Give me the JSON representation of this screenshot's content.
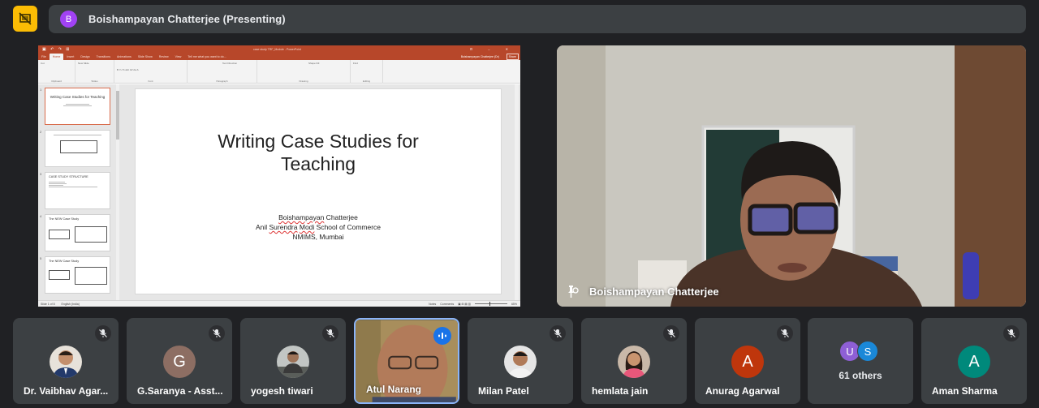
{
  "presenter": {
    "avatar_letter": "B",
    "avatar_color": "#a142f4",
    "label": "Boishampayan Chatterjee (Presenting)",
    "present_button_icon": "stop-presenting-icon",
    "present_button_color": "#fbbc04"
  },
  "powerpoint": {
    "window_title": "case study TRF_Module - PowerPoint",
    "user": "Boishampayan Chatterjee (Dr)",
    "share_label": "Share",
    "tabs": [
      "File",
      "Home",
      "Insert",
      "Design",
      "Transitions",
      "Animations",
      "Slide Show",
      "Review",
      "View",
      "Tell me what you want to do..."
    ],
    "active_tab": "Home",
    "ribbon_groups": [
      {
        "label": "Clipboard",
        "items": [
          "Paste",
          "Cut",
          "Copy",
          "Format Painter"
        ]
      },
      {
        "label": "Slides",
        "items": [
          "New Slide",
          "Layout",
          "Reset",
          "Section"
        ]
      },
      {
        "label": "Font",
        "items": [
          "B I U S abc AV Aa A"
        ]
      },
      {
        "label": "Paragraph",
        "items": [
          "Text Direction",
          "Align Text",
          "Convert to SmartArt"
        ]
      },
      {
        "label": "Drawing",
        "items": [
          "Arrange",
          "Quick Styles",
          "Shape Fill",
          "Shape Outline",
          "Shape Effects"
        ]
      },
      {
        "label": "Editing",
        "items": [
          "Find",
          "Replace",
          "Select"
        ]
      }
    ],
    "thumbnails": [
      {
        "num": "1",
        "title": "Writing Case Studies for Teaching",
        "selected": true
      },
      {
        "num": "2",
        "title": "",
        "selected": false
      },
      {
        "num": "3",
        "title": "CASE STUDY STRUCTURE",
        "selected": false
      },
      {
        "num": "4",
        "title": "The NEW Case Study",
        "selected": false
      },
      {
        "num": "5",
        "title": "The NEW Case Study",
        "selected": false
      }
    ],
    "slide": {
      "title_line1": "Writing Case Studies for",
      "title_line2": "Teaching",
      "author_first": "Boishampayan",
      "author_last": " Chatterjee",
      "inst_a": "Anil ",
      "inst_b": "Surendra",
      "inst_c": " ",
      "inst_d": "Modi",
      "inst_e": " School of Commerce",
      "location": "NMIMS, Mumbai"
    },
    "status": {
      "slide_count": "Slide 1 of 8",
      "language": "English (India)",
      "notes": "Notes",
      "comments": "Comments",
      "zoom": "65%"
    }
  },
  "main_video": {
    "name": "Boishampayan Chatterjee",
    "pin_icon": "pin-icon"
  },
  "participants": [
    {
      "name": "Dr. Vaibhav Agar...",
      "avatar_type": "photo",
      "photo_bg": "#e7e2da",
      "muted": true
    },
    {
      "name": "G.Saranya - Asst...",
      "avatar_type": "letter",
      "letter": "G",
      "color": "#8d6e63",
      "muted": true
    },
    {
      "name": "yogesh tiwari",
      "avatar_type": "photo",
      "photo_bg": "#c2c6c4",
      "muted": true
    },
    {
      "name": "Atul Narang",
      "avatar_type": "video",
      "muted": false,
      "speaking": true
    },
    {
      "name": "Milan Patel",
      "avatar_type": "photo",
      "photo_bg": "#e5e5e5",
      "muted": true
    },
    {
      "name": "hemlata jain",
      "avatar_type": "photo",
      "photo_bg": "#c9b8a8",
      "muted": true
    },
    {
      "name": "Anurag Agarwal",
      "avatar_type": "letter",
      "letter": "A",
      "color": "#bf360c",
      "muted": true
    },
    {
      "name": "Aman Sharma",
      "avatar_type": "letter",
      "letter": "A",
      "color": "#00897b",
      "muted": true
    }
  ],
  "others": {
    "label": "61 others",
    "avatars": [
      {
        "letter": "U",
        "color": "#8e5fd6"
      },
      {
        "letter": "S",
        "color": "#1a88d8"
      }
    ]
  }
}
